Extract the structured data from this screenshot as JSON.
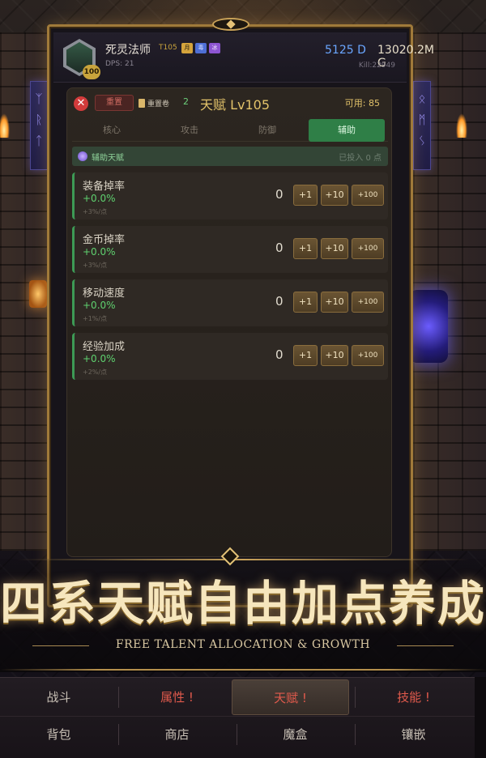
{
  "header": {
    "hero_name": "死灵法师",
    "tier": "T105",
    "chips": [
      "月",
      "毒",
      "冰"
    ],
    "level_badge": "100",
    "dps": "DPS: 21",
    "currency_d": "5125 D",
    "currency_g": "13020.2M G",
    "kills": "Kill:22949"
  },
  "panel": {
    "reset_label": "重置",
    "scroll_label": "重置卷",
    "scroll_count": "2",
    "title": "天赋 Lv105",
    "available": "可用: 85",
    "tabs": [
      {
        "label": "核心"
      },
      {
        "label": "攻击"
      },
      {
        "label": "防御"
      },
      {
        "label": "辅助"
      }
    ],
    "active_tab": "辅助",
    "section_title": "辅助天赋",
    "section_allocated": "已投入 0 点",
    "stats": [
      {
        "name": "装备掉率",
        "value": "+0.0%",
        "rate": "+3%/点",
        "points": "0"
      },
      {
        "name": "金币掉率",
        "value": "+0.0%",
        "rate": "+3%/点",
        "points": "0"
      },
      {
        "name": "移动速度",
        "value": "+0.0%",
        "rate": "+1%/点",
        "points": "0"
      },
      {
        "name": "经验加成",
        "value": "+0.0%",
        "rate": "+2%/点",
        "points": "0"
      }
    ],
    "buttons": {
      "plus1": "+1",
      "plus10": "+10",
      "plus100": "+100"
    }
  },
  "promo": {
    "title": "四系天赋自由加点养成",
    "subtitle": "FREE TALENT ALLOCATION & GROWTH"
  },
  "nav": {
    "row1": [
      {
        "label": "战斗"
      },
      {
        "label": "属性 !"
      },
      {
        "label": "天赋 !"
      },
      {
        "label": "技能 !"
      }
    ],
    "row2": [
      {
        "label": "背包"
      },
      {
        "label": "商店"
      },
      {
        "label": "魔盒"
      },
      {
        "label": "镶嵌"
      }
    ]
  },
  "colors": {
    "accent_gold": "#e3c36a",
    "stat_green": "#5fd16f",
    "active_tab": "#2f7f47",
    "alert_red": "#e15a4c",
    "currency_blue": "#6aa6ff"
  }
}
